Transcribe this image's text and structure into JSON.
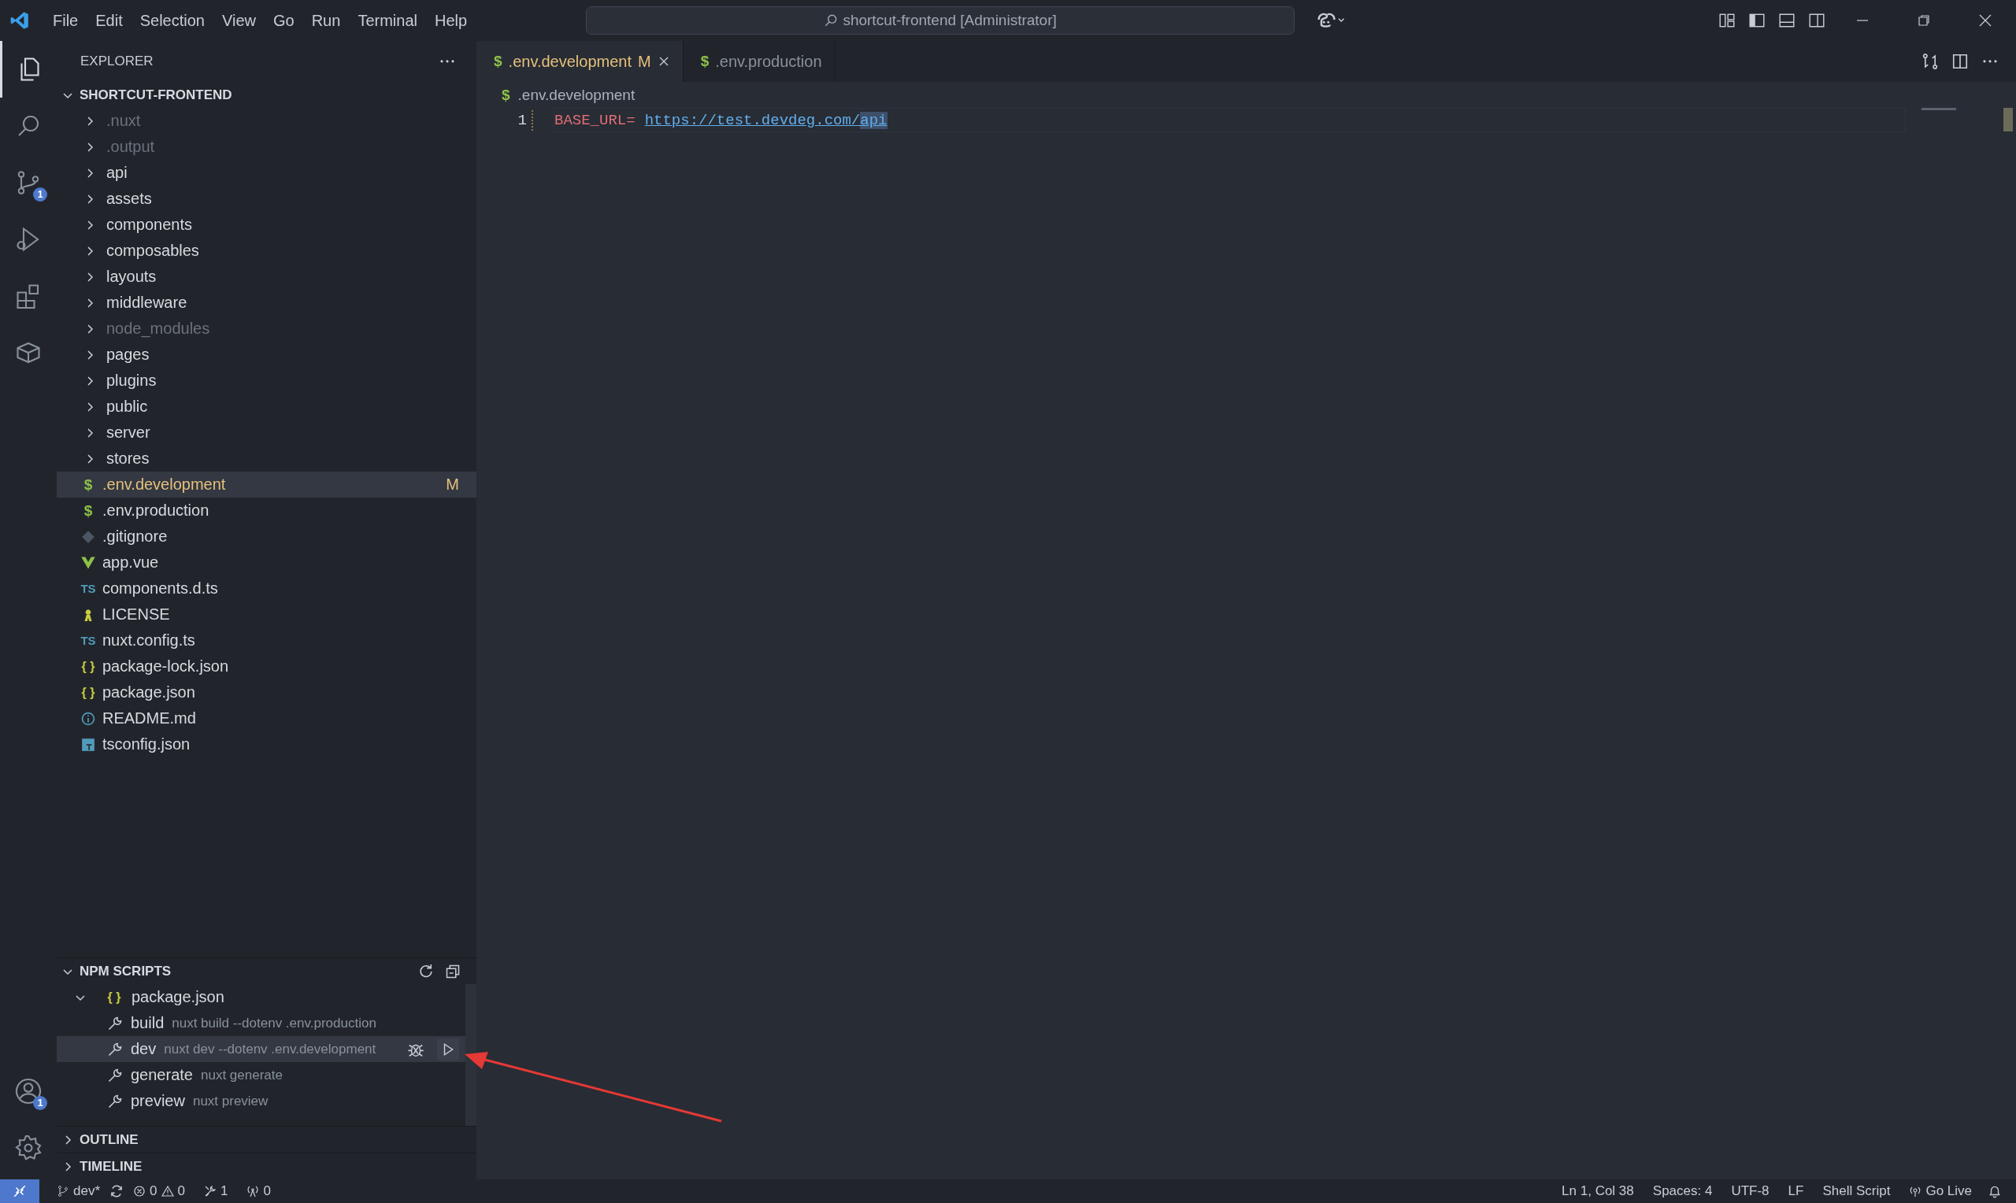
{
  "menu": [
    "File",
    "Edit",
    "Selection",
    "View",
    "Go",
    "Run",
    "Terminal",
    "Help"
  ],
  "command_center": {
    "text": "shortcut-frontend [Administrator]"
  },
  "activity_bar": [
    {
      "kind": "files",
      "selected": true
    },
    {
      "kind": "search",
      "selected": false
    },
    {
      "kind": "source-control",
      "selected": false,
      "badge": "1"
    },
    {
      "kind": "run-debug",
      "selected": false
    },
    {
      "kind": "extensions",
      "selected": false
    },
    {
      "kind": "box",
      "selected": false
    }
  ],
  "activity_bottom": [
    {
      "kind": "account",
      "badge": "1"
    },
    {
      "kind": "settings"
    }
  ],
  "explorer": {
    "title": "EXPLORER",
    "project": "SHORTCUT-FRONTEND",
    "items": [
      {
        "kind": "folder",
        "label": ".nuxt",
        "dimmed": true,
        "selected": false
      },
      {
        "kind": "folder",
        "label": ".output",
        "dimmed": true,
        "selected": false
      },
      {
        "kind": "folder",
        "label": "api",
        "dimmed": false,
        "selected": false
      },
      {
        "kind": "folder",
        "label": "assets",
        "dimmed": false,
        "selected": false
      },
      {
        "kind": "folder",
        "label": "components",
        "dimmed": false,
        "selected": false
      },
      {
        "kind": "folder",
        "label": "composables",
        "dimmed": false,
        "selected": false
      },
      {
        "kind": "folder",
        "label": "layouts",
        "dimmed": false,
        "selected": false
      },
      {
        "kind": "folder",
        "label": "middleware",
        "dimmed": false,
        "selected": false
      },
      {
        "kind": "folder",
        "label": "node_modules",
        "dimmed": true,
        "selected": false
      },
      {
        "kind": "folder",
        "label": "pages",
        "dimmed": false,
        "selected": false
      },
      {
        "kind": "folder",
        "label": "plugins",
        "dimmed": false,
        "selected": false
      },
      {
        "kind": "folder",
        "label": "public",
        "dimmed": false,
        "selected": false
      },
      {
        "kind": "folder",
        "label": "server",
        "dimmed": false,
        "selected": false
      },
      {
        "kind": "folder",
        "label": "stores",
        "dimmed": false,
        "selected": false
      },
      {
        "kind": "dollar",
        "icon": "$",
        "label": ".env.development",
        "dimmed": false,
        "selected": true,
        "badge": "M"
      },
      {
        "kind": "dollar",
        "icon": "$",
        "label": ".env.production",
        "dimmed": false,
        "selected": false
      },
      {
        "kind": "git",
        "label": ".gitignore",
        "dimmed": false,
        "selected": false
      },
      {
        "kind": "vue",
        "label": "app.vue",
        "dimmed": false,
        "selected": false
      },
      {
        "kind": "ts",
        "icon": "TS",
        "label": "components.d.ts",
        "dimmed": false,
        "selected": false
      },
      {
        "kind": "license",
        "label": "LICENSE",
        "dimmed": false,
        "selected": false
      },
      {
        "kind": "ts",
        "icon": "TS",
        "label": "nuxt.config.ts",
        "dimmed": false,
        "selected": false
      },
      {
        "kind": "json",
        "icon": "{ }",
        "label": "package-lock.json",
        "dimmed": false,
        "selected": false
      },
      {
        "kind": "json",
        "icon": "{ }",
        "label": "package.json",
        "dimmed": false,
        "selected": false
      },
      {
        "kind": "info",
        "label": "README.md",
        "dimmed": false,
        "selected": false
      },
      {
        "kind": "tsconfig",
        "label": "tsconfig.json",
        "dimmed": false,
        "selected": false
      }
    ]
  },
  "npm_scripts": {
    "title": "NPM SCRIPTS",
    "expanded": true,
    "package": {
      "icon": "{ }",
      "label": "package.json",
      "expanded": true
    },
    "scripts": [
      {
        "name": "build",
        "command": "nuxt build --dotenv .env.production",
        "selected": false
      },
      {
        "name": "dev",
        "command": "nuxt dev --dotenv .env.development",
        "selected": true
      },
      {
        "name": "generate",
        "command": "nuxt generate",
        "selected": false
      },
      {
        "name": "preview",
        "command": "nuxt preview",
        "selected": false
      }
    ]
  },
  "collapsed_sections": [
    {
      "title": "OUTLINE",
      "expanded": false
    },
    {
      "title": "TIMELINE",
      "expanded": false
    }
  ],
  "tabs": [
    {
      "icon": "$",
      "label": ".env.development",
      "modified": "M",
      "selected": true
    },
    {
      "icon": "$",
      "label": ".env.production",
      "selected": false
    }
  ],
  "breadcrumb": {
    "icon": "$",
    "label": ".env.development"
  },
  "code": [
    {
      "number": "1",
      "tokens": [
        {
          "kind": "key",
          "text": "BASE_URL="
        },
        {
          "kind": "link",
          "text": "https://test.devdeg.com/"
        },
        {
          "kind": "selected-link",
          "text": "api"
        }
      ]
    }
  ],
  "status_bar": {
    "branch": "dev*",
    "errors": "0",
    "warnings": "0",
    "tools": "1",
    "ports": "0",
    "right": [
      "Ln 1, Col 38",
      "Spaces: 4",
      "UTF-8",
      "LF",
      "Shell Script"
    ],
    "go_live": "Go Live"
  }
}
